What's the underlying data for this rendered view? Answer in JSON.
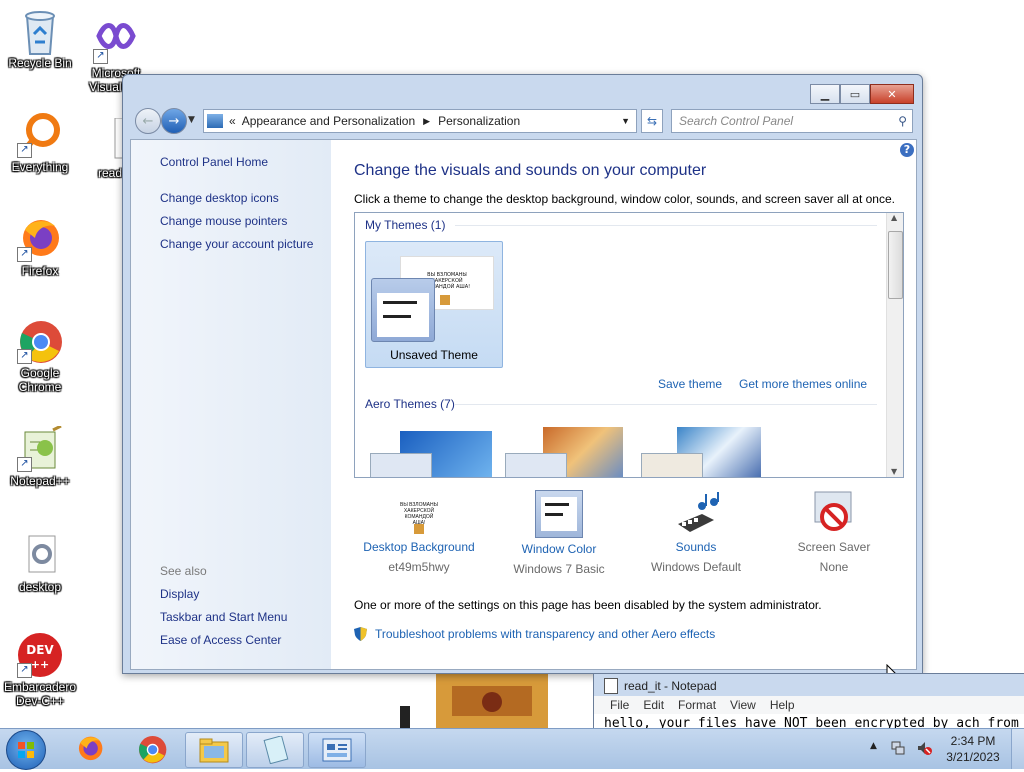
{
  "desktop": {
    "icons": [
      {
        "label": "Recycle Bin"
      },
      {
        "label": "Microsoft Visual S..."
      },
      {
        "label": "Everything"
      },
      {
        "label": "read"
      },
      {
        "label": "Firefox"
      },
      {
        "label": "Google Chrome"
      },
      {
        "label": "Notepad++"
      },
      {
        "label": "desktop"
      },
      {
        "label": "Embarcadero Dev-C++"
      }
    ]
  },
  "window": {
    "breadcrumb_root": "Appearance and Personalization",
    "breadcrumb_leaf": "Personalization",
    "search_placeholder": "Search Control Panel",
    "left_links": [
      "Control Panel Home",
      "Change desktop icons",
      "Change mouse pointers",
      "Change your account picture"
    ],
    "see_also_label": "See also",
    "see_also_links": [
      "Display",
      "Taskbar and Start Menu",
      "Ease of Access Center"
    ],
    "heading": "Change the visuals and sounds on your computer",
    "subheading": "Click a theme to change the desktop background, window color, sounds, and screen saver all at once.",
    "my_themes_label": "My Themes (1)",
    "unsaved_theme_label": "Unsaved Theme",
    "wallpaper_text": "ВЫ ВЗЛОМАНЫ ХАКЕРСКОЙ КОМАНДОЙ АША!",
    "save_theme": "Save theme",
    "get_more_themes": "Get more themes online",
    "aero_themes_label": "Aero Themes (7)",
    "bottom": [
      {
        "title": "Desktop Background",
        "value": "et49m5hwy"
      },
      {
        "title": "Window Color",
        "value": "Windows 7 Basic"
      },
      {
        "title": "Sounds",
        "value": "Windows Default"
      },
      {
        "title": "Screen Saver",
        "value": "None"
      }
    ],
    "disabled_notice": "One or more of the settings on this page has been disabled by the system administrator.",
    "troubleshoot_link": "Troubleshoot problems with transparency and other Aero effects"
  },
  "notepad": {
    "title": "read_it - Notepad",
    "menu": [
      "File",
      "Edit",
      "Format",
      "View",
      "Help"
    ],
    "content": "hello, your files have NOT been encrypted by ach from"
  },
  "taskbar": {
    "time": "2:34 PM",
    "date": "3/21/2023"
  }
}
